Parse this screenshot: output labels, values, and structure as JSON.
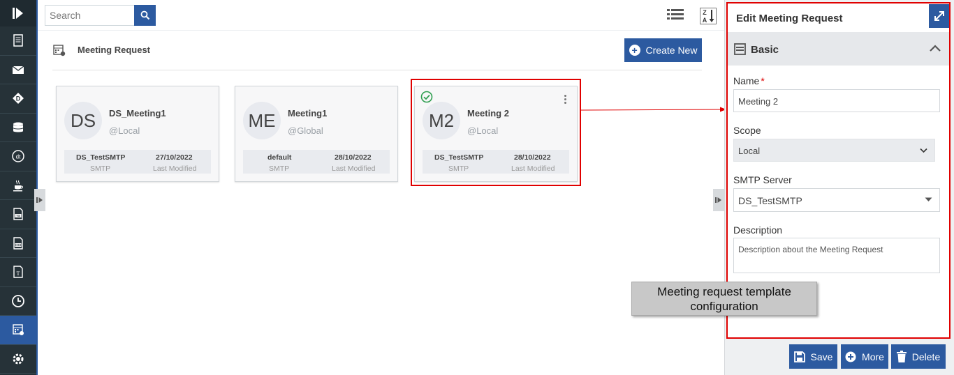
{
  "search": {
    "placeholder": "Search"
  },
  "page": {
    "title": "Meeting Request",
    "create_label": "Create New"
  },
  "cards": [
    {
      "initials": "DS",
      "name": "DS_Meeting1",
      "scope": "@Local",
      "smtp_value": "DS_TestSMTP",
      "smtp_label": "SMTP",
      "modified_value": "27/10/2022",
      "modified_label": "Last Modified"
    },
    {
      "initials": "ME",
      "name": "Meeting1",
      "scope": "@Global",
      "smtp_value": "default",
      "smtp_label": "SMTP",
      "modified_value": "28/10/2022",
      "modified_label": "Last Modified"
    },
    {
      "initials": "M2",
      "name": "Meeting 2",
      "scope": "@Local",
      "smtp_value": "DS_TestSMTP",
      "smtp_label": "SMTP",
      "modified_value": "28/10/2022",
      "modified_label": "Last Modified"
    }
  ],
  "panel": {
    "title": "Edit Meeting Request",
    "section": "Basic",
    "name_label": "Name",
    "required_mark": "*",
    "name_value": "Meeting 2",
    "scope_label": "Scope",
    "scope_value": "Local",
    "smtp_label": "SMTP Server",
    "smtp_value": "DS_TestSMTP",
    "description_label": "Description",
    "description_value": "Description about the Meeting Request"
  },
  "callout": {
    "line1": "Meeting request template",
    "line2": "configuration"
  },
  "actions": {
    "save": "Save",
    "more": "More",
    "delete": "Delete"
  },
  "colors": {
    "accent": "#2c5aa0",
    "sidebar": "#263238",
    "highlight": "#e00000",
    "success": "#2e9e4f"
  }
}
